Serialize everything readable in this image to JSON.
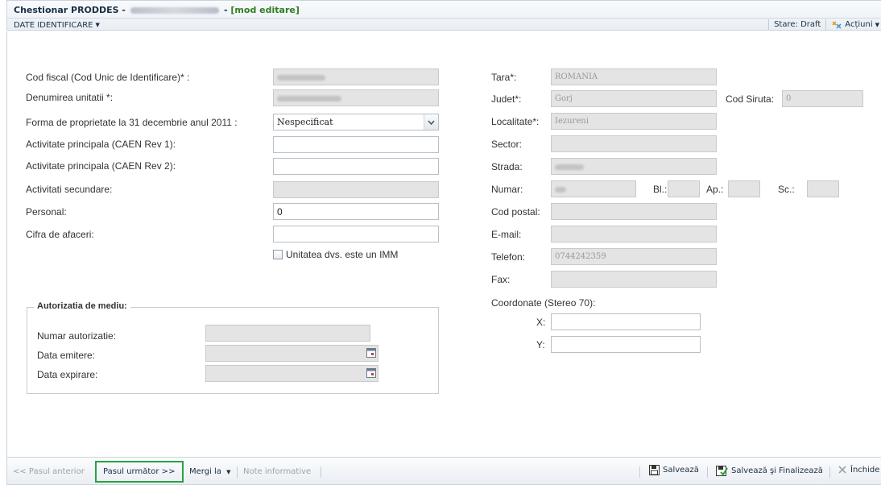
{
  "window": {
    "title_prefix": "Chestionar PRODDES -",
    "title_sep": "-",
    "mode": "[mod editare]"
  },
  "toolbar": {
    "section_menu": "DATE IDENTIFICARE",
    "status": "Stare: Draft",
    "actions": "Acțiuni"
  },
  "left": {
    "cod_fiscal_label": "Cod fiscal (Cod Unic de Identificare)* :",
    "denumire_label": "Denumirea unitatii *:",
    "forma_label": "Forma de proprietate la 31 decembrie anul 2011 :",
    "forma_value": "Nespecificat",
    "caen1_label": "Activitate principala (CAEN Rev 1):",
    "caen1_value": "",
    "caen2_label": "Activitate principala (CAEN Rev 2):",
    "caen2_value": "",
    "secundare_label": "Activitati secundare:",
    "personal_label": "Personal:",
    "personal_value": "0",
    "cifra_label": "Cifra de afaceri:",
    "cifra_value": "",
    "imm_label": "Unitatea dvs. este un IMM"
  },
  "autorizatie": {
    "legend": "Autorizatia de mediu:",
    "numar_label": "Numar autorizatie:",
    "emitere_label": "Data emitere:",
    "expirare_label": "Data expirare:"
  },
  "right": {
    "tara_label": "Tara*:",
    "tara_value": "ROMANIA",
    "judet_label": "Judet*:",
    "judet_value": "Gorj",
    "siruta_label": "Cod Siruta:",
    "siruta_value": "0",
    "localitate_label": "Localitate*:",
    "localitate_value": "Iezureni",
    "sector_label": "Sector:",
    "strada_label": "Strada:",
    "numar_label": "Numar:",
    "bl_label": "Bl.:",
    "ap_label": "Ap.:",
    "sc_label": "Sc.:",
    "cod_postal_label": "Cod postal:",
    "email_label": "E-mail:",
    "telefon_label": "Telefon:",
    "telefon_value": "0744242359",
    "fax_label": "Fax:",
    "coordonate_label": "Coordonate (Stereo 70):",
    "x_label": "X:",
    "x_value": "",
    "y_label": "Y:",
    "y_value": ""
  },
  "bottom": {
    "prev": "<< Pasul anterior",
    "next": "Pasul următor >>",
    "goto": "Mergi la",
    "notes": "Note informative",
    "save": "Salvează",
    "save_finalize": "Salvează şi Finalizează",
    "close": "Închide"
  },
  "colors": {
    "mode_green": "#2f7d21",
    "highlight_green": "#27a343",
    "disabled_field": "#e4e4e4"
  },
  "icons": [
    "chevron-down-icon",
    "actions-icon",
    "calendar-icon",
    "save-icon",
    "save-finalize-icon",
    "close-icon"
  ]
}
